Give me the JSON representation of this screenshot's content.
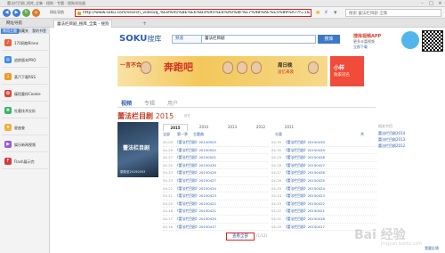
{
  "window": {
    "title": "蕾法栏目剧_搜库_全集 - 搜狗 - 专题 - 搜狗浏览器",
    "controls": [
      "–",
      "□",
      "×"
    ]
  },
  "toolbar": {
    "back_icon": "arrow-left-icon",
    "forward_icon": "arrow-right-icon",
    "address_label": "网址导航",
    "url": "http://www.soku.com/search_video/q_%E8%95%BE%E6%B3%95%E6%A0%8F%E7%9B%AE%E5%89%A7?f=1&kb=04",
    "search_placeholder": "搜索 蕾法栏目剧 全集"
  },
  "tabs": [
    {
      "label": "网址导航",
      "active": false
    },
    {
      "label": "蕾法栏目剧_搜库_全集 - 搜狗",
      "active": true
    }
  ],
  "sidebar": {
    "tabs": [
      "常用主题",
      "收藏夹",
      "我的书签"
    ],
    "items": [
      {
        "label": "170网络Rinne",
        "color": "#e8613d",
        "glyph": "♪"
      },
      {
        "label": "追踪版本PRO",
        "color": "#3d8be8",
        "glyph": "◎"
      },
      {
        "label": "蒸汽下载RSS",
        "color": "#f09a26",
        "glyph": "↓"
      },
      {
        "label": "痛悟重伴Cookie",
        "color": "#d84a3b",
        "glyph": "✿"
      },
      {
        "label": "社客技术交析",
        "color": "#3db46a",
        "glyph": "✚"
      },
      {
        "label": "星座查",
        "color": "#f0b23a",
        "glyph": "★"
      },
      {
        "label": "娱乐新闻视频",
        "color": "#9a5ad6",
        "glyph": "▶"
      },
      {
        "label": "Flash展示完",
        "color": "#d53a3a",
        "glyph": "F"
      }
    ]
  },
  "site": {
    "logo": "SOKU",
    "logo_cn": "搜库",
    "category": "频道",
    "query": "蕾法栏目剧",
    "search_button": "搜库",
    "promo": {
      "line1": "搜库视频APP",
      "line2": "更多丰富视频",
      "line3": "立即下载"
    }
  },
  "banner": {
    "slogan": "一言不合",
    "title": "奔跑吧",
    "sub": "周日晚",
    "sub2": "追忆来袭",
    "ad_title": "小样",
    "ad_sub": "独家冠名"
  },
  "filter_tabs": [
    {
      "label": "视频",
      "active": true
    },
    {
      "label": "专辑",
      "active": false
    },
    {
      "label": "用户",
      "active": false
    }
  ],
  "show": {
    "title": "蕾法栏目剧",
    "year": "2015",
    "meta": "综艺",
    "poster_title": "蕾法栏目剧",
    "poster_date": "更新至20150503"
  },
  "year_tabs": [
    {
      "label": "2015",
      "active": true
    },
    {
      "label": "2014",
      "active": false
    },
    {
      "label": "2013",
      "active": false
    },
    {
      "label": "2012",
      "active": false
    },
    {
      "label": "2011",
      "active": false
    }
  ],
  "ep_head": {
    "left": "全部",
    "mid": "第一季",
    "right": "主题曲",
    "col2": "分类",
    "col3": "共"
  },
  "episodes_left": [
    {
      "date": "05-03",
      "title": "《蕾法栏目剧》20150503 "
    },
    {
      "date": "04-29",
      "title": "《蕾法栏目剧》20150502"
    },
    {
      "date": "04-27",
      "title": "《蕾法栏目剧》20150501"
    },
    {
      "date": "04-25",
      "title": "《蕾法栏目剧》20150430"
    },
    {
      "date": "04-23",
      "title": "《蕾法栏目剧》20150429"
    },
    {
      "date": "04-23",
      "title": "《蕾法栏目剧》20150427"
    },
    {
      "date": "04-22",
      "title": "《蕾法栏目剧》20150424"
    },
    {
      "date": "04-21",
      "title": "《蕾法栏目剧》20150423"
    },
    {
      "date": "04-20",
      "title": "《蕾法栏目剧》20150422"
    },
    {
      "date": "04-18",
      "title": "《蕾法栏目剧》20150421"
    },
    {
      "date": "04-17",
      "title": "《蕾法栏目剧》20150420"
    },
    {
      "date": "04-16",
      "title": "《蕾法栏目剧》20150417"
    }
  ],
  "episodes_right": [
    {
      "date": "04-30",
      "title": "《蕾法栏目剧》20150430"
    },
    {
      "date": "04-30",
      "title": "《蕾法栏目剧》20150429"
    },
    {
      "date": "04-29",
      "title": "《蕾法栏目剧》20150428"
    },
    {
      "date": "04-28",
      "title": "《蕾法栏目剧》20150427"
    },
    {
      "date": "04-27",
      "title": "《蕾法栏目剧》20150426"
    },
    {
      "date": "04-26",
      "title": "《蕾法栏目剧》20150425"
    },
    {
      "date": "04-25",
      "title": "《蕾法栏目剧》20150424"
    },
    {
      "date": "04-24",
      "title": "《蕾法栏目剧》20150423"
    },
    {
      "date": "04-23",
      "title": "《蕾法栏目剧》20150422"
    },
    {
      "date": "04-22",
      "title": "《蕾法栏目剧》20150421"
    },
    {
      "date": "04-21",
      "title": "《蕾法栏目剧》20150418"
    },
    {
      "date": "04-20",
      "title": "《蕾法栏目剧》20150417"
    }
  ],
  "pager": {
    "label": "查看全部",
    "after": "(1/13)"
  },
  "right_col": {
    "heading": "相关节目",
    "links": [
      "蕾法栏目剧2014",
      "蕾法栏目剧2013",
      "蕾法栏目剧2012"
    ]
  },
  "footer": {
    "feedback": "我要反馈"
  },
  "watermark": {
    "text": "Bai 经验",
    "sub": "jingyan.baidu.com"
  }
}
